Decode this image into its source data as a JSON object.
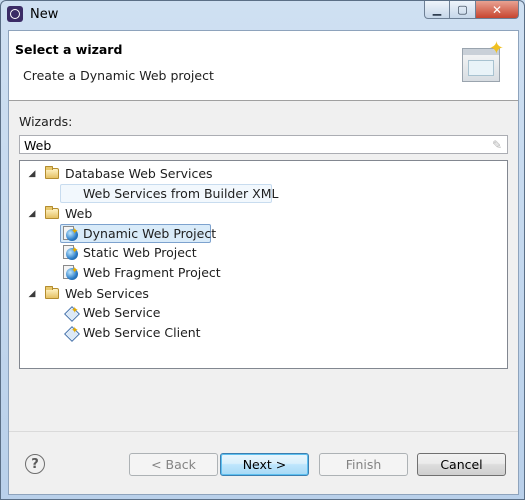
{
  "window": {
    "title": "New",
    "controls": {
      "minimize": "▁",
      "maximize": "▢",
      "close": "✕"
    }
  },
  "header": {
    "title": "Select a wizard",
    "description": "Create a Dynamic Web project"
  },
  "wizards_label": "Wizards:",
  "filter": {
    "value": "Web"
  },
  "tree": [
    {
      "label": "Database Web Services",
      "expanded": true,
      "children": [
        {
          "label": "Web Services from Builder XML",
          "icon": "none",
          "state": "hovered"
        }
      ]
    },
    {
      "label": "Web",
      "expanded": true,
      "children": [
        {
          "label": "Dynamic Web Project",
          "icon": "dynamic-web-project-icon",
          "state": "selected"
        },
        {
          "label": "Static Web Project",
          "icon": "static-web-project-icon",
          "state": "normal"
        },
        {
          "label": "Web Fragment Project",
          "icon": "web-fragment-project-icon",
          "state": "normal"
        }
      ]
    },
    {
      "label": "Web Services",
      "expanded": true,
      "children": [
        {
          "label": "Web Service",
          "icon": "web-service-icon",
          "state": "normal"
        },
        {
          "label": "Web Service Client",
          "icon": "web-service-client-icon",
          "state": "normal"
        }
      ]
    }
  ],
  "buttons": {
    "help": "?",
    "back": "< Back",
    "next": "Next >",
    "finish": "Finish",
    "cancel": "Cancel"
  }
}
